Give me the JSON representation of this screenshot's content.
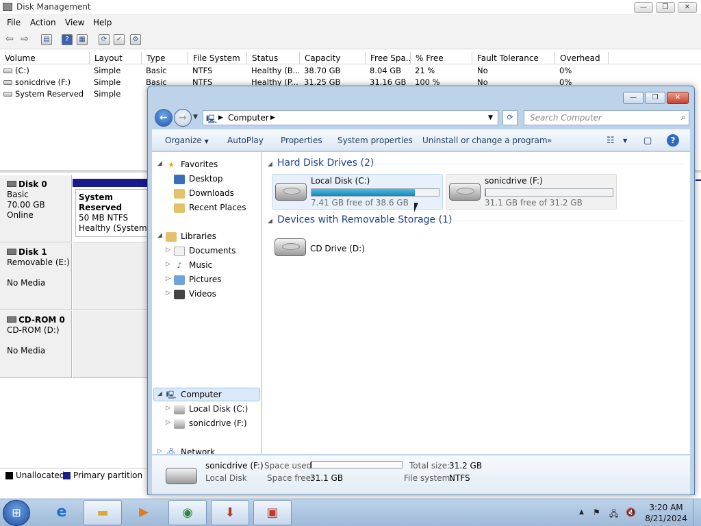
{
  "disk_management": {
    "title": "Disk Management",
    "menu": [
      "File",
      "Action",
      "View",
      "Help"
    ],
    "volume_columns": [
      "Volume",
      "Layout",
      "Type",
      "File System",
      "Status",
      "Capacity",
      "Free Spa...",
      "% Free",
      "Fault Tolerance",
      "Overhead"
    ],
    "volumes": [
      {
        "volume": "(C:)",
        "layout": "Simple",
        "type": "Basic",
        "fs": "NTFS",
        "status": "Healthy (B...",
        "capacity": "38.70 GB",
        "free": "8.04 GB",
        "pct": "21 %",
        "fault": "No",
        "overhead": "0%"
      },
      {
        "volume": "sonicdrive (F:)",
        "layout": "Simple",
        "type": "Basic",
        "fs": "NTFS",
        "status": "Healthy (P...",
        "capacity": "31.25 GB",
        "free": "31.16 GB",
        "pct": "100 %",
        "fault": "No",
        "overhead": "0%"
      },
      {
        "volume": "System Reserved",
        "layout": "Simple",
        "type": "",
        "fs": "",
        "status": "",
        "capacity": "",
        "free": "",
        "pct": "",
        "fault": "",
        "overhead": ""
      }
    ],
    "disks": [
      {
        "name": "Disk 0",
        "line1": "Basic",
        "line2": "70.00 GB",
        "line3": "Online"
      },
      {
        "name": "Disk 1",
        "line1": "Removable (E:)",
        "line2": "",
        "line3": "No Media"
      },
      {
        "name": "CD-ROM 0",
        "line1": "CD-ROM (D:)",
        "line2": "",
        "line3": "No Media"
      }
    ],
    "partition": {
      "name": "System Reserved",
      "size": "50 MB NTFS",
      "status": "Healthy (System, A"
    },
    "legend": {
      "unallocated": "Unallocated",
      "primary": "Primary partition"
    },
    "colors": {
      "primary": "#1a1a8c",
      "unallocated": "#000000"
    }
  },
  "explorer": {
    "breadcrumb": "Computer",
    "search_placeholder": "Search Computer",
    "commands": [
      "Organize",
      "AutoPlay",
      "Properties",
      "System properties",
      "Uninstall or change a program",
      "»"
    ],
    "nav": {
      "favorites": "Favorites",
      "favorites_items": [
        "Desktop",
        "Downloads",
        "Recent Places"
      ],
      "libraries": "Libraries",
      "library_items": [
        "Documents",
        "Music",
        "Pictures",
        "Videos"
      ],
      "computer": "Computer",
      "computer_items": [
        "Local Disk (C:)",
        "sonicdrive (F:)"
      ],
      "network": "Network"
    },
    "groups": {
      "hdd": "Hard Disk Drives (2)",
      "removable": "Devices with Removable Storage (1)"
    },
    "drives": [
      {
        "name": "Local Disk (C:)",
        "free": "7.41 GB free of 38.6 GB",
        "used_fraction": 0.81
      },
      {
        "name": "sonicdrive (F:)",
        "free": "31.1 GB free of 31.2 GB",
        "used_fraction": 0.003
      }
    ],
    "removable": [
      {
        "name": "CD Drive (D:)"
      }
    ],
    "details": {
      "name": "sonicdrive (F:)",
      "type": "Local Disk",
      "space_used_label": "Space used:",
      "space_free_label": "Space free:",
      "space_free": "31.1 GB",
      "total_size_label": "Total size:",
      "total_size": "31.2 GB",
      "fs_label": "File system:",
      "fs": "NTFS"
    }
  },
  "taskbar": {
    "time": "3:20 AM",
    "date": "8/21/2024"
  }
}
